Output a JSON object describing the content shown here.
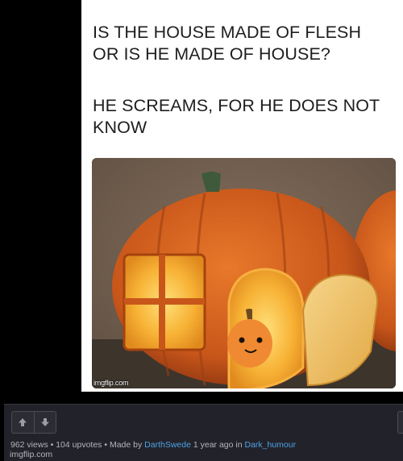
{
  "meme": {
    "caption_line1": "IS THE HOUSE MADE OF FLESH",
    "caption_line2": "OR IS HE MADE OF HOUSE?",
    "caption_line3": "HE SCREAMS, FOR HE DOES NOT",
    "caption_line4": "KNOW",
    "watermark": "imgflip.com"
  },
  "footer": {
    "upvote_icon": "arrow-up-icon",
    "downvote_icon": "arrow-down-icon",
    "views": "962 views",
    "sep1": " • ",
    "upvotes": "104 upvotes",
    "sep2": " • ",
    "made_by_prefix": "Made by ",
    "author": "DarthSwede",
    "time": " 1 year ago in ",
    "stream": "Dark_humour",
    "site": "imgflip.com"
  },
  "colors": {
    "background": "#000000",
    "footer_bg": "#22232a",
    "link": "#4ea1e4",
    "pumpkin": "#d9641c",
    "glow": "#f7b235"
  }
}
